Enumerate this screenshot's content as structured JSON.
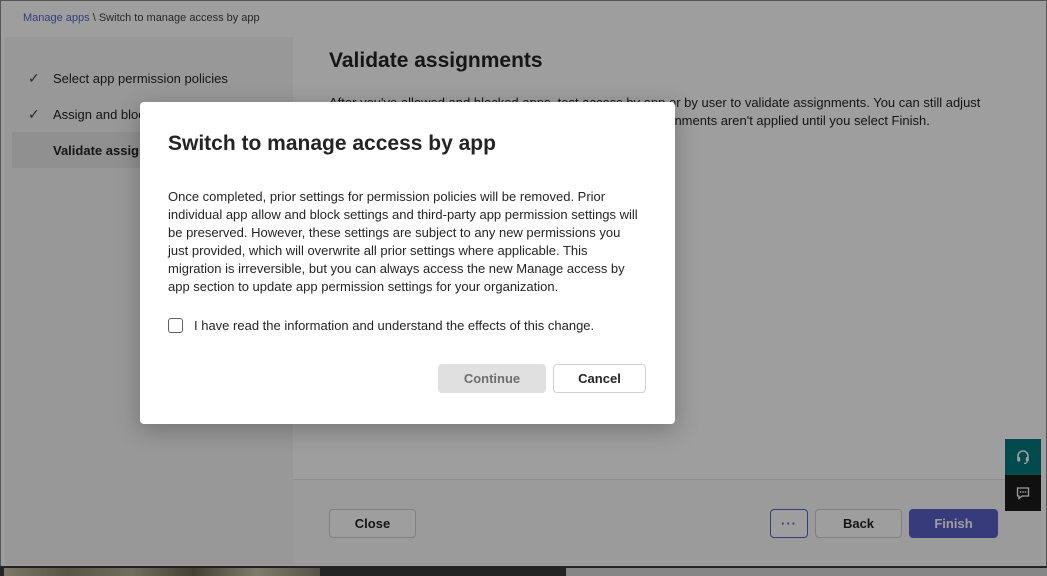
{
  "breadcrumb": {
    "root": "Manage apps",
    "separator": " \\ ",
    "current": "Switch to manage access by app"
  },
  "steps": [
    {
      "label": "Select app permission policies",
      "done": true
    },
    {
      "label": "Assign and block apps",
      "done": true
    },
    {
      "label": "Validate assignments",
      "done": false,
      "active": true
    }
  ],
  "main": {
    "title": "Validate assignments",
    "description": "After you've allowed and blocked apps, test access by app or by user to validate assignments. You can still adjust assignments by going back to the previous page. Your assignments aren't applied until you select Finish."
  },
  "footer": {
    "close_label": "Close",
    "more_label": "···",
    "back_label": "Back",
    "finish_label": "Finish"
  },
  "dialog": {
    "title": "Switch to manage access by app",
    "body": "Once completed, prior settings for permission policies will be removed. Prior individual app allow and block settings and third-party app permission settings will be preserved. However, these settings are subject to any new permissions you just provided, which will overwrite all prior settings where applicable. This migration is irreversible, but you can always access the new Manage access by app section to update app permission settings for your organization.",
    "consent_label": "I have read the information and understand the effects of this change.",
    "consent_checked": false,
    "continue_label": "Continue",
    "cancel_label": "Cancel"
  },
  "floating": {
    "help_icon": "headset-icon",
    "feedback_icon": "feedback-icon"
  },
  "colors": {
    "accent": "#5b5fc7",
    "help_bg": "#03787c",
    "feedback_bg": "#1b1b1b"
  }
}
